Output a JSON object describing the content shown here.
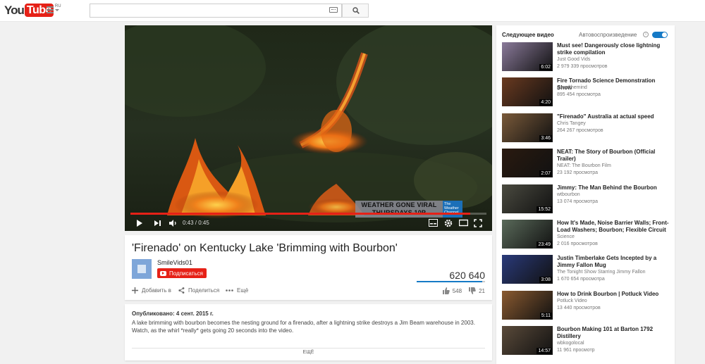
{
  "header": {
    "logo_you": "You",
    "logo_tube": "Tube",
    "logo_region": "RU",
    "search_placeholder": ""
  },
  "player": {
    "current_time": "0:43",
    "duration": "0:45",
    "time_display": "0:43 / 0:45",
    "progress_fraction": 0.955,
    "overlay_line1": "WEATHER GONE VIRAL",
    "overlay_line2": "THURSDAYS 10P",
    "overlay_channel_line1": "The",
    "overlay_channel_line2": "Weather",
    "overlay_channel_line3": "Channel"
  },
  "video": {
    "title": "'Firenado' on Kentucky Lake 'Brimming with Bourbon'",
    "channel": "SmileVids01",
    "subscribe_label": "Подписаться",
    "views": "620 640",
    "like_fraction": 0.96,
    "add_to_label": "Добавить в",
    "share_label": "Поделиться",
    "more_label": "Ещё",
    "likes": "548",
    "dislikes": "21"
  },
  "description": {
    "published": "Опубликовано: 4 сент. 2015 г.",
    "text": "A lake brimming with bourbon becomes the nesting ground for a firenado, after a lightning strike destroys a Jim Beam warehouse in 2003. Watch, as the whirl *really* gets going 20 seconds into the video.",
    "show_more": "ЕЩЁ"
  },
  "sidebar": {
    "up_next": "Следующее видео",
    "autoplay": "Автовоспроизведение",
    "autoplay_on": true,
    "items": [
      {
        "title": "Must see! Dangerously close lightning strike compilation",
        "channel": "Just Good Vids",
        "views": "2 979 339 просмотров",
        "duration": "6:02",
        "thumb_color": "#8a7a9a"
      },
      {
        "title": "Fire Tornado Science Demonstration Show",
        "channel": "guardthemind",
        "views": "895 454 просмотра",
        "duration": "4:20",
        "thumb_color": "#6a3a20"
      },
      {
        "title": "\"Firenado\" Australia at actual speed",
        "channel": "Chris Tangey",
        "views": "264 267 просмотров",
        "duration": "3:46",
        "thumb_color": "#7a5a3a"
      },
      {
        "title": "NEAT: The Story of Bourbon (Official Trailer)",
        "channel": "NEAT: The Bourbon Film",
        "views": "23 192 просмотра",
        "duration": "2:07",
        "thumb_color": "#2a1a10"
      },
      {
        "title": "Jimmy: The Man Behind the Bourbon",
        "channel": "wtbourbon",
        "views": "13 074 просмотра",
        "duration": "15:52",
        "thumb_color": "#4a4a40"
      },
      {
        "title": "How It's Made, Noise Barrier Walls; Front-Load Washers; Bourbon; Flexible Circuit",
        "channel": "Science",
        "views": "2 016 просмотров",
        "duration": "23:49",
        "thumb_color": "#5a6a5a"
      },
      {
        "title": "Justin Timberlake Gets Incepted by a Jimmy Fallon Mug",
        "channel": "The Tonight Show Starring Jimmy Fallon",
        "views": "1 670 654 просмотра",
        "duration": "3:08",
        "thumb_color": "#2a3a7a"
      },
      {
        "title": "How to Drink Bourbon | Potluck Video",
        "channel": "Potluck Video",
        "views": "13 440 просмотров",
        "duration": "5:11",
        "thumb_color": "#8a5a30"
      },
      {
        "title": "Bourbon Making 101 at Barton 1792 Distillery",
        "channel": "wbkogolocal",
        "views": "11 961 просмотр",
        "duration": "14:57",
        "thumb_color": "#5a4a3a"
      }
    ]
  }
}
